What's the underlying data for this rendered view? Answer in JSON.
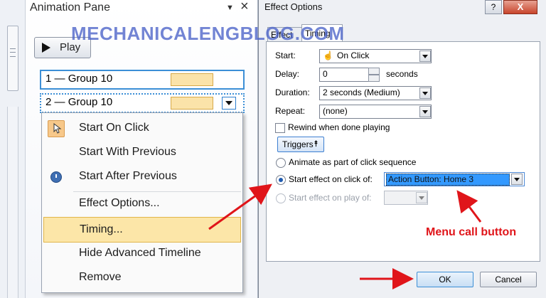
{
  "watermark": "MECHANICALENGBLOG.COM",
  "animation_pane": {
    "title": "Animation Pane",
    "dropdown_glyph": "▼",
    "close_glyph": "×",
    "play_label": "Play",
    "rows": [
      {
        "number": "1",
        "name": "Group 10"
      },
      {
        "number": "2",
        "name": "Group 10"
      }
    ]
  },
  "context_menu": {
    "items": [
      {
        "label": "Start On Click",
        "icon": "mouse-click-icon"
      },
      {
        "label": "Start With Previous"
      },
      {
        "label": "Start After Previous",
        "icon": "clock-icon"
      },
      {
        "label": "Effect Options..."
      },
      {
        "label": "Timing..."
      },
      {
        "label": "Hide Advanced Timeline"
      },
      {
        "label": "Remove"
      }
    ]
  },
  "dialog": {
    "title": "Effect Options",
    "help_glyph": "?",
    "close_glyph": "X",
    "tabs": [
      "Effect",
      "Timing"
    ],
    "start_label": "Start:",
    "start_value": "On Click",
    "delay_label": "Delay:",
    "delay_value": "0",
    "delay_unit": "seconds",
    "duration_label": "Duration:",
    "duration_value": "2 seconds (Medium)",
    "repeat_label": "Repeat:",
    "repeat_value": "(none)",
    "rewind_label": "Rewind when done playing",
    "triggers_label": "Triggers",
    "triggers_glyph": "⯭",
    "radio_animate": "Animate as part of click sequence",
    "radio_click": "Start effect on click of:",
    "trigger_value": "Action Button: Home 3",
    "radio_play": "Start effect on play of:",
    "ok_label": "OK",
    "cancel_label": "Cancel"
  },
  "annotation": {
    "menu_call": "Menu call button",
    "arrow_color": "#e0151a"
  },
  "colors": {
    "selection_blue": "#3c8fd6",
    "timing_bar": "#fbe3a9",
    "menu_highlight": "#fce6a8"
  }
}
